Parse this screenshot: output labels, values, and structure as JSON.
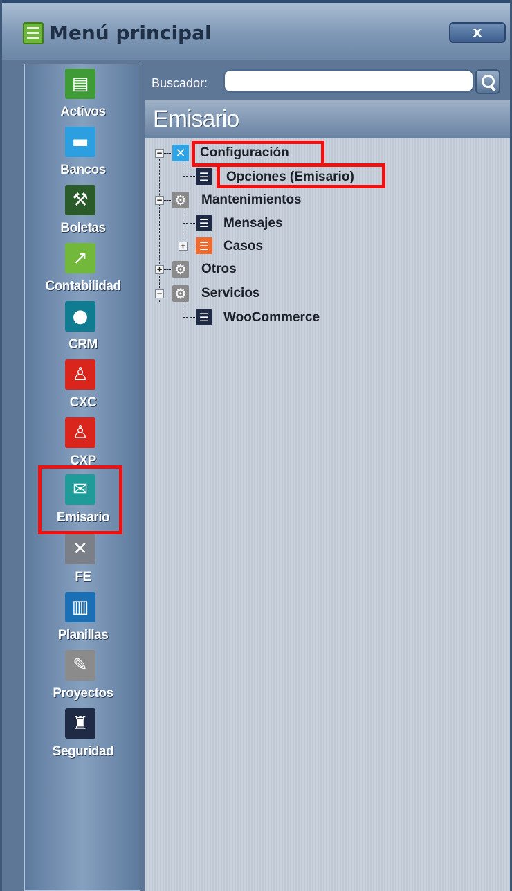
{
  "window": {
    "title": "Menú principal",
    "close_label": "x"
  },
  "sidebar": {
    "items": [
      {
        "label": "Activos",
        "icon": "cash-register-icon",
        "color": "#3f9b35"
      },
      {
        "label": "Bancos",
        "icon": "briefcase-icon",
        "color": "#2b9fe0"
      },
      {
        "label": "Boletas",
        "icon": "person-shoveling-icon",
        "color": "#2b5b2a"
      },
      {
        "label": "Contabilidad",
        "icon": "chart-up-icon",
        "color": "#72b83a"
      },
      {
        "label": "CRM",
        "icon": "globe-icon",
        "color": "#0f7c91"
      },
      {
        "label": "CXC",
        "icon": "person-money-icon",
        "color": "#d9251c"
      },
      {
        "label": "CXP",
        "icon": "person-scatter-icon",
        "color": "#d9251c"
      },
      {
        "label": "Emisario",
        "icon": "envelope-icon",
        "color": "#1f9c9a"
      },
      {
        "label": "FE",
        "icon": "tools-icon",
        "color": "#7a7f88"
      },
      {
        "label": "Planillas",
        "icon": "document-icon",
        "color": "#1b6fb4"
      },
      {
        "label": "Proyectos",
        "icon": "ruler-pencil-icon",
        "color": "#8b8b8b"
      },
      {
        "label": "Seguridad",
        "icon": "castle-icon",
        "color": "#1f2b44"
      }
    ]
  },
  "search": {
    "label": "Buscador:",
    "value": "",
    "placeholder": ""
  },
  "section": {
    "title": "Emisario"
  },
  "tree": {
    "nodes": [
      {
        "label": "Configuración",
        "icon": "tools-icon",
        "expanded": true
      },
      {
        "label": "Opciones (Emisario)",
        "icon": "list-icon"
      },
      {
        "label": "Mantenimientos",
        "icon": "gear-icon",
        "expanded": true
      },
      {
        "label": "Mensajes",
        "icon": "list-icon"
      },
      {
        "label": "Casos",
        "icon": "list-orange-icon",
        "expanded": false
      },
      {
        "label": "Otros",
        "icon": "gear-icon",
        "expanded": false
      },
      {
        "label": "Servicios",
        "icon": "gear-icon",
        "expanded": true
      },
      {
        "label": "WooCommerce",
        "icon": "list-icon"
      }
    ]
  },
  "colors": {
    "highlight": "#ee1111",
    "panel": "#5e7796"
  }
}
